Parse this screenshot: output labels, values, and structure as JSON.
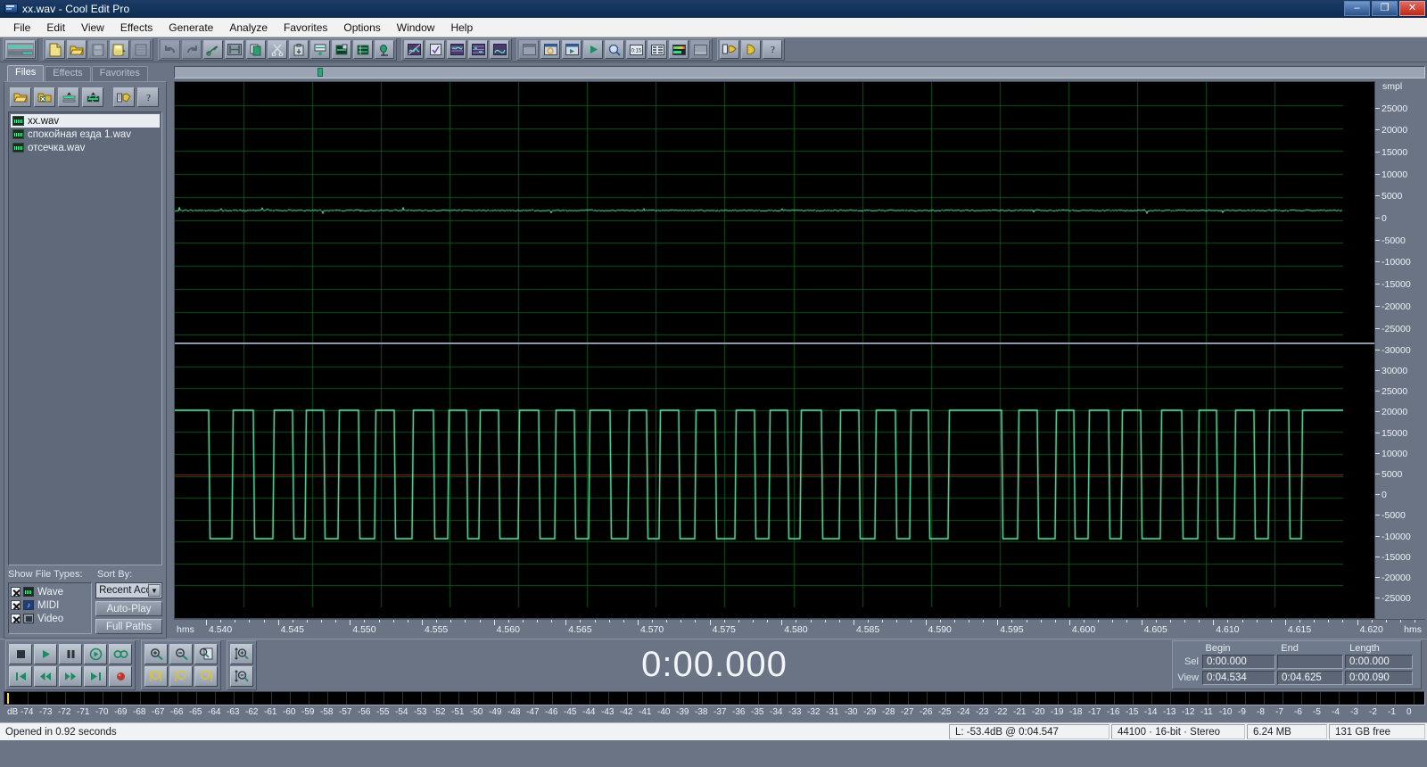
{
  "window": {
    "title": "xx.wav - Cool Edit Pro",
    "minimize": "–",
    "maximize": "❐",
    "close": "✕"
  },
  "menu": [
    {
      "label": "File"
    },
    {
      "label": "Edit"
    },
    {
      "label": "View"
    },
    {
      "label": "Effects"
    },
    {
      "label": "Generate"
    },
    {
      "label": "Analyze"
    },
    {
      "label": "Favorites"
    },
    {
      "label": "Options"
    },
    {
      "label": "Window"
    },
    {
      "label": "Help"
    }
  ],
  "toolbar": {
    "groups": [
      {
        "name": "workspace",
        "buttons": [
          {
            "icon": "multitrack-view-icon"
          }
        ]
      },
      {
        "name": "file",
        "buttons": [
          {
            "icon": "new-file-icon"
          },
          {
            "icon": "open-file-icon"
          },
          {
            "icon": "save-icon"
          },
          {
            "icon": "save-as-icon"
          },
          {
            "icon": "save-all-icon"
          }
        ]
      },
      {
        "name": "edit",
        "buttons": [
          {
            "icon": "undo-icon"
          },
          {
            "icon": "redo-icon"
          },
          {
            "icon": "trim-icon"
          },
          {
            "icon": "select-all-icon"
          },
          {
            "icon": "copy-icon"
          },
          {
            "icon": "cut-icon"
          },
          {
            "icon": "paste-icon"
          },
          {
            "icon": "mix-paste-icon"
          },
          {
            "icon": "paste-to-new-icon"
          },
          {
            "icon": "mix-down-icon"
          },
          {
            "icon": "record-insert-icon"
          }
        ]
      },
      {
        "name": "view",
        "buttons": [
          {
            "icon": "waveform-view-icon"
          },
          {
            "icon": "checkbox-view-icon"
          },
          {
            "icon": "spectral-view-icon"
          },
          {
            "icon": "spectral-pan-icon"
          },
          {
            "icon": "spectral-phase-icon"
          }
        ]
      },
      {
        "name": "display",
        "buttons": [
          {
            "icon": "window-icon"
          },
          {
            "icon": "file-info-icon"
          },
          {
            "icon": "file-play-icon"
          },
          {
            "icon": "play-icon"
          },
          {
            "icon": "zoom-icon"
          },
          {
            "icon": "time-display-icon"
          },
          {
            "icon": "cue-list-icon"
          },
          {
            "icon": "level-meter-icon"
          },
          {
            "icon": "placeholder-icon"
          }
        ]
      },
      {
        "name": "tools",
        "buttons": [
          {
            "icon": "script-icon"
          },
          {
            "icon": "batch-icon"
          },
          {
            "icon": "help-icon"
          }
        ]
      }
    ]
  },
  "organizer": {
    "tabs": [
      {
        "label": "Files",
        "active": true
      },
      {
        "label": "Effects",
        "active": false
      },
      {
        "label": "Favorites",
        "active": false
      }
    ],
    "buttons": [
      {
        "icon": "open-folder-icon"
      },
      {
        "icon": "close-file-icon"
      },
      {
        "icon": "insert-multitrack-icon"
      },
      {
        "icon": "insert-play-icon"
      },
      {
        "icon": "batch-process-icon"
      },
      {
        "icon": "help-icon"
      }
    ],
    "files": [
      {
        "name": "xx.wav",
        "selected": true
      },
      {
        "name": "спокойная езда 1.wav",
        "selected": false
      },
      {
        "name": "отсечка.wav",
        "selected": false
      }
    ],
    "show_file_types_label": "Show File Types:",
    "sort_by_label": "Sort By:",
    "file_types": [
      {
        "label": "Wave",
        "checked": true,
        "icon": "wave-file-icon"
      },
      {
        "label": "MIDI",
        "checked": true,
        "icon": "midi-file-icon"
      },
      {
        "label": "Video",
        "checked": true,
        "icon": "video-file-icon"
      }
    ],
    "sort_value": "Recent Acc",
    "auto_play_label": "Auto-Play",
    "full_paths_label": "Full Paths"
  },
  "waveform": {
    "vertical_unit": "smpl",
    "channel_top_ticks": [
      "25000",
      "20000",
      "15000",
      "10000",
      "5000",
      "0",
      "-5000",
      "-10000",
      "-15000",
      "-20000",
      "-25000",
      "-30000"
    ],
    "channel_bottom_ticks": [
      "30000",
      "25000",
      "20000",
      "15000",
      "10000",
      "5000",
      "0",
      "-5000",
      "-10000",
      "-15000",
      "-20000",
      "-25000"
    ],
    "time_unit_left": "hms",
    "time_unit_right": "hms",
    "time_labels": [
      "4.540",
      "4.545",
      "4.550",
      "4.555",
      "4.560",
      "4.565",
      "4.570",
      "4.575",
      "4.580",
      "4.585",
      "4.590",
      "4.595",
      "4.600",
      "4.605",
      "4.610",
      "4.615",
      "4.620"
    ],
    "colors": {
      "background": "#000000",
      "grid": "#10521f",
      "wave": "#6cf5b0",
      "center_line": "#8a2b2b"
    }
  },
  "transport": {
    "row1": [
      {
        "icon": "stop-icon"
      },
      {
        "icon": "play-icon"
      },
      {
        "icon": "pause-icon"
      },
      {
        "icon": "play-from-cursor-icon"
      },
      {
        "icon": "loop-icon"
      }
    ],
    "row2": [
      {
        "icon": "go-to-beginning-icon"
      },
      {
        "icon": "rewind-icon"
      },
      {
        "icon": "fast-forward-icon"
      },
      {
        "icon": "go-to-end-icon"
      },
      {
        "icon": "record-icon"
      }
    ],
    "zoom_row1": [
      {
        "icon": "zoom-in-horizontal-icon"
      },
      {
        "icon": "zoom-out-horizontal-icon"
      },
      {
        "icon": "zoom-full-icon"
      }
    ],
    "zoom_row2": [
      {
        "icon": "zoom-to-selection-icon"
      },
      {
        "icon": "zoom-to-left-edge-icon"
      },
      {
        "icon": "zoom-to-right-edge-icon"
      }
    ],
    "zoom_vert1": [
      {
        "icon": "zoom-in-vertical-icon"
      }
    ],
    "zoom_vert2": [
      {
        "icon": "zoom-out-vertical-icon"
      }
    ],
    "big_time": "0:00.000"
  },
  "selection_panel": {
    "headers": [
      "Begin",
      "End",
      "Length"
    ],
    "rows": [
      {
        "tag": "Sel",
        "begin": "0:00.000",
        "end": "",
        "length": "0:00.000"
      },
      {
        "tag": "View",
        "begin": "0:04.534",
        "end": "0:04.625",
        "length": "0:00.090"
      }
    ]
  },
  "level_meter": {
    "unit": "dB",
    "ticks": [
      "-74",
      "-73",
      "-72",
      "-71",
      "-70",
      "-69",
      "-68",
      "-67",
      "-66",
      "-65",
      "-64",
      "-63",
      "-62",
      "-61",
      "-60",
      "-59",
      "-58",
      "-57",
      "-56",
      "-55",
      "-54",
      "-53",
      "-52",
      "-51",
      "-50",
      "-49",
      "-48",
      "-47",
      "-46",
      "-45",
      "-44",
      "-43",
      "-42",
      "-41",
      "-40",
      "-39",
      "-38",
      "-37",
      "-36",
      "-35",
      "-34",
      "-33",
      "-32",
      "-31",
      "-30",
      "-29",
      "-28",
      "-27",
      "-26",
      "-25",
      "-24",
      "-23",
      "-22",
      "-21",
      "-20",
      "-19",
      "-18",
      "-17",
      "-16",
      "-15",
      "-14",
      "-13",
      "-12",
      "-11",
      "-10",
      "-9",
      "-8",
      "-7",
      "-6",
      "-5",
      "-4",
      "-3",
      "-2",
      "-1",
      "0"
    ]
  },
  "status_bar": {
    "message": "Opened in 0.92 seconds",
    "level": "L: -53.4dB @  0:04.547",
    "format": "44100 · 16-bit · Stereo",
    "size": "6.24 MB",
    "free": "131 GB free"
  }
}
